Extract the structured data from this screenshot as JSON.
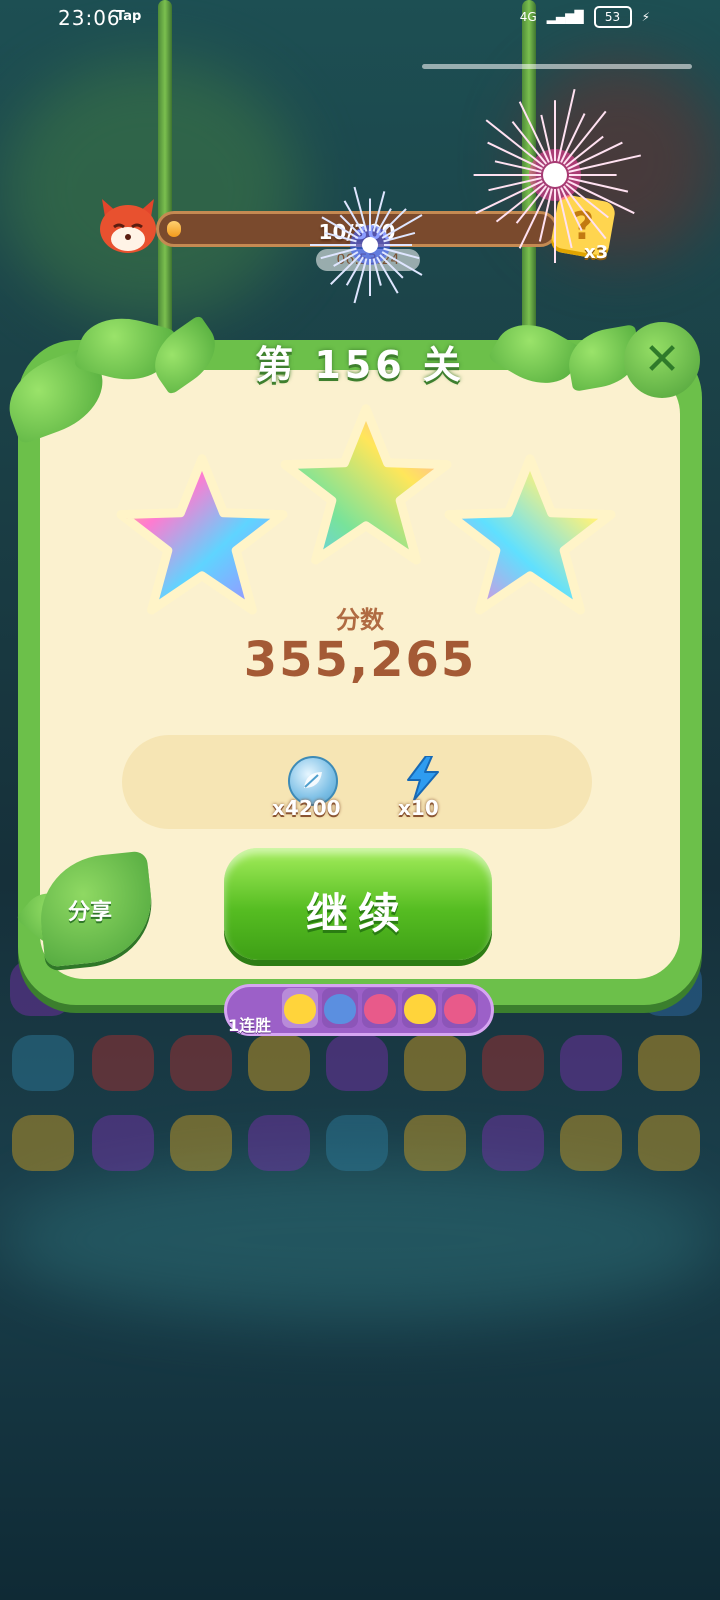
{
  "status_bar": {
    "time": "23:06",
    "carrier_app": "Tap",
    "network": "4G",
    "battery": "53"
  },
  "event_progress": {
    "value_text": "10/300",
    "fraction": 0.033,
    "countdown": "06:53:24",
    "mystery_icon": "?",
    "mystery_multiplier": "x3"
  },
  "result_panel": {
    "level_title": "第 156 关",
    "stars_earned": 3,
    "score_label": "分数",
    "score_value": "355,265"
  },
  "rewards": [
    {
      "icon": "leaf-coin-icon",
      "amount": "x4200"
    },
    {
      "icon": "lightning-icon",
      "amount": "x10"
    }
  ],
  "actions": {
    "share_label": "分享",
    "continue_label": "继续"
  },
  "streak": {
    "label": "连胜",
    "count": "1"
  },
  "colors": {
    "panel_green": "#6cc04a",
    "panel_cream": "#fbf1cf",
    "score_brown": "#a45a35",
    "button_green": "#56bd22",
    "streak_purple": "#9c60c8"
  }
}
